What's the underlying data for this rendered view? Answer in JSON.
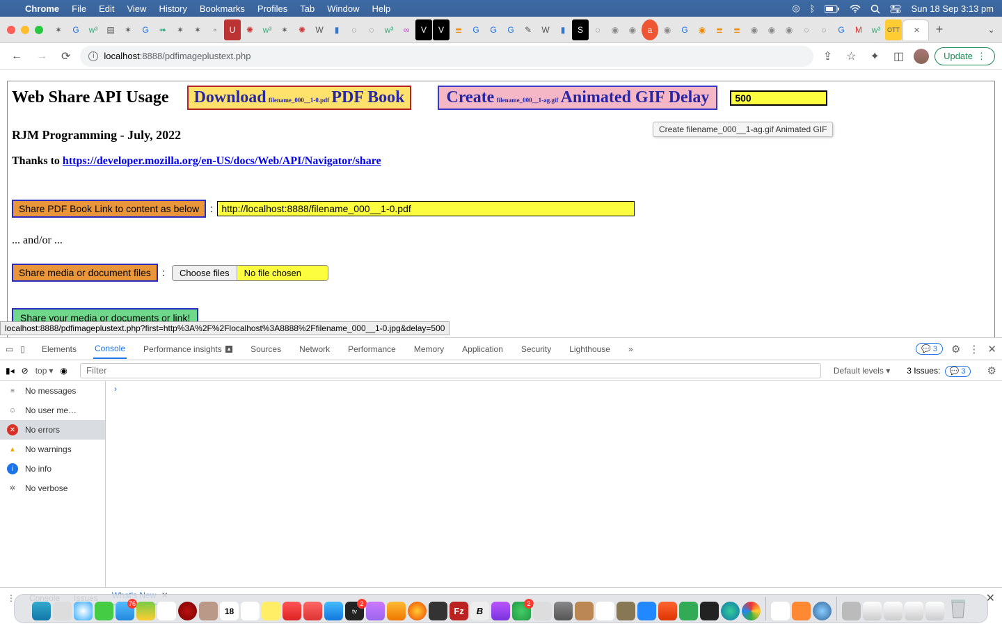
{
  "menubar": {
    "appname": "Chrome",
    "items": [
      "File",
      "Edit",
      "View",
      "History",
      "Bookmarks",
      "Profiles",
      "Tab",
      "Window",
      "Help"
    ],
    "datetime": "Sun 18 Sep  3:13 pm"
  },
  "omnibox": {
    "host": "localhost",
    "port": ":8888",
    "path": "/pdfimageplustext.php"
  },
  "update_label": "Update",
  "page": {
    "title": "Web Share API Usage",
    "download_big1": "Download",
    "download_small": "filename_000__1-0.pdf",
    "download_big2": "PDF Book",
    "create_big1": "Create",
    "create_small": "filename_000__1-ag.gif",
    "create_big2": "Animated GIF Delay",
    "delay_value": "500",
    "tooltip": "Create filename_000__1-ag.gif Animated GIF",
    "subtitle": "RJM Programming - July, 2022",
    "thanks_prefix": "Thanks to ",
    "thanks_link": "https://developer.mozilla.org/en-US/docs/Web/API/Navigator/share",
    "share_pdf_label": "Share PDF Book Link to content as below",
    "url_value": "http://localhost:8888/filename_000__1-0.pdf",
    "andor": "... and/or ...",
    "share_media_label": "Share media or document files",
    "choose_files": "Choose files",
    "no_file": "No file chosen",
    "share_final": "Share your media or documents or link!",
    "status_hover": "localhost:8888/pdfimageplustext.php?first=http%3A%2F%2Flocalhost%3A8888%2Ffilename_000__1-0.jpg&delay=500"
  },
  "devtools": {
    "tabs": [
      "Elements",
      "Console",
      "Performance insights",
      "Sources",
      "Network",
      "Performance",
      "Memory",
      "Application",
      "Security",
      "Lighthouse"
    ],
    "active_tab": "Console",
    "more": "»",
    "msg_count": "3",
    "top_select": "top",
    "filter_placeholder": "Filter",
    "levels": "Default levels",
    "issues_label": "3 Issues:",
    "issues_count": "3",
    "sidebar": {
      "messages": "No messages",
      "userme": "No user me…",
      "errors": "No errors",
      "warnings": "No warnings",
      "info": "No info",
      "verbose": "No verbose"
    },
    "prompt": "›",
    "footer": {
      "console": "Console",
      "issues": "Issues",
      "whatsnew": "What's New"
    }
  },
  "dock_badges": {
    "mail": "76",
    "cal_day": "18",
    "apptv": "2"
  }
}
